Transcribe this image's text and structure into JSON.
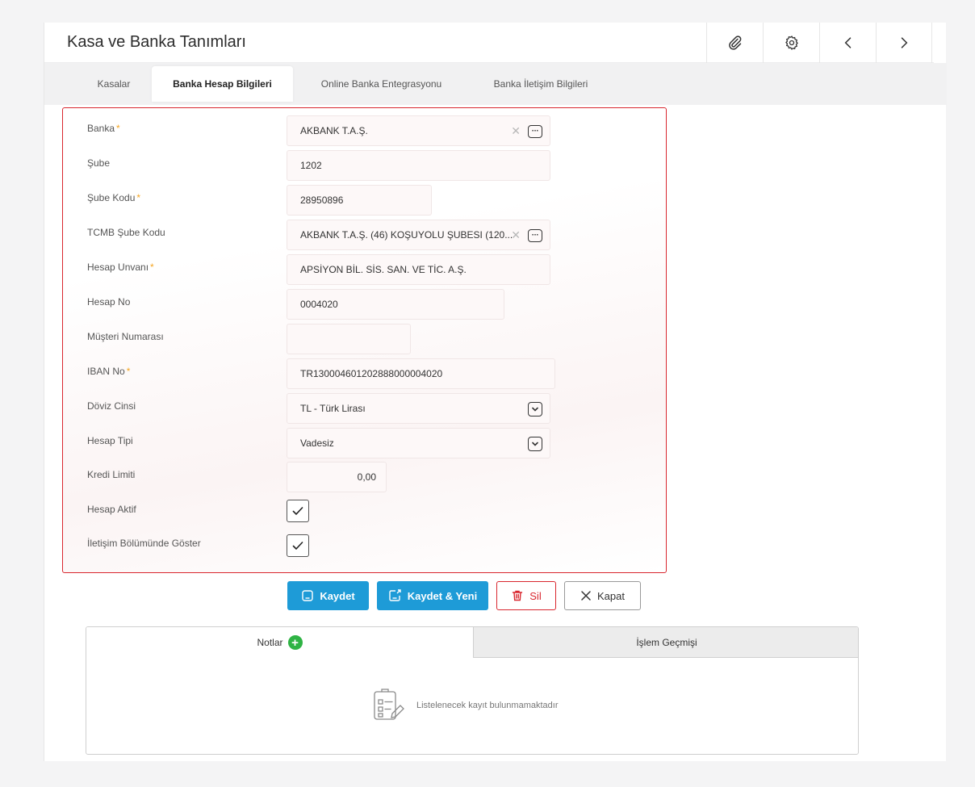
{
  "app": {
    "title": "Kasa ve Banka Tanımları",
    "toolbar": [
      "paperclip-icon",
      "gear-icon",
      "chevron-left-icon",
      "chevron-right-icon"
    ]
  },
  "tabs": [
    {
      "label": "Kasalar",
      "active": false
    },
    {
      "label": "Banka Hesap Bilgileri",
      "active": true
    },
    {
      "label": "Online Banka Entegrasyonu",
      "active": false
    },
    {
      "label": "Banka İletişim Bilgileri",
      "active": false
    }
  ],
  "form": {
    "banka": {
      "label": "Banka",
      "required": "*",
      "value": "AKBANK T.A.Ş."
    },
    "sube": {
      "label": "Şube",
      "value": "1202"
    },
    "sube_kodu": {
      "label": "Şube Kodu",
      "required": "*",
      "value": "28950896"
    },
    "tcmb_sube_kodu": {
      "label": "TCMB Şube Kodu",
      "value": "AKBANK T.A.Ş. (46) KOŞUYOLU ŞUBESI (120..."
    },
    "hesap_unvani": {
      "label": "Hesap Unvanı",
      "required": "*",
      "value": "APSİYON BİL. SİS. SAN. VE TİC. A.Ş."
    },
    "hesap_no": {
      "label": "Hesap No",
      "value": "0004020"
    },
    "musteri_numarasi": {
      "label": "Müşteri Numarası",
      "value": ""
    },
    "iban_no": {
      "label": "IBAN No",
      "required": "*",
      "value": "TR130004601202888000004020"
    },
    "doviz_cinsi": {
      "label": "Döviz Cinsi",
      "value": "TL - Türk Lirası"
    },
    "hesap_tipi": {
      "label": "Hesap Tipi",
      "value": "Vadesiz"
    },
    "kredi_limiti": {
      "label": "Kredi Limiti",
      "value": "0,00"
    },
    "hesap_aktif": {
      "label": "Hesap Aktif",
      "checked": true
    },
    "iletisim_goster": {
      "label": "İletişim Bölümünde Göster",
      "checked": true
    }
  },
  "actions": {
    "save": "Kaydet",
    "save_new": "Kaydet & Yeni",
    "delete": "Sil",
    "close": "Kapat"
  },
  "bottom_panel": {
    "notes_tab": "Notlar",
    "history_tab": "İşlem Geçmişi",
    "empty_message": "Listelenecek kayıt bulunmamaktadır"
  },
  "colors": {
    "accent_blue": "#1e9bd7",
    "danger_red": "#d9262e",
    "required_orange": "#f5a623",
    "add_green": "#2fb344"
  }
}
